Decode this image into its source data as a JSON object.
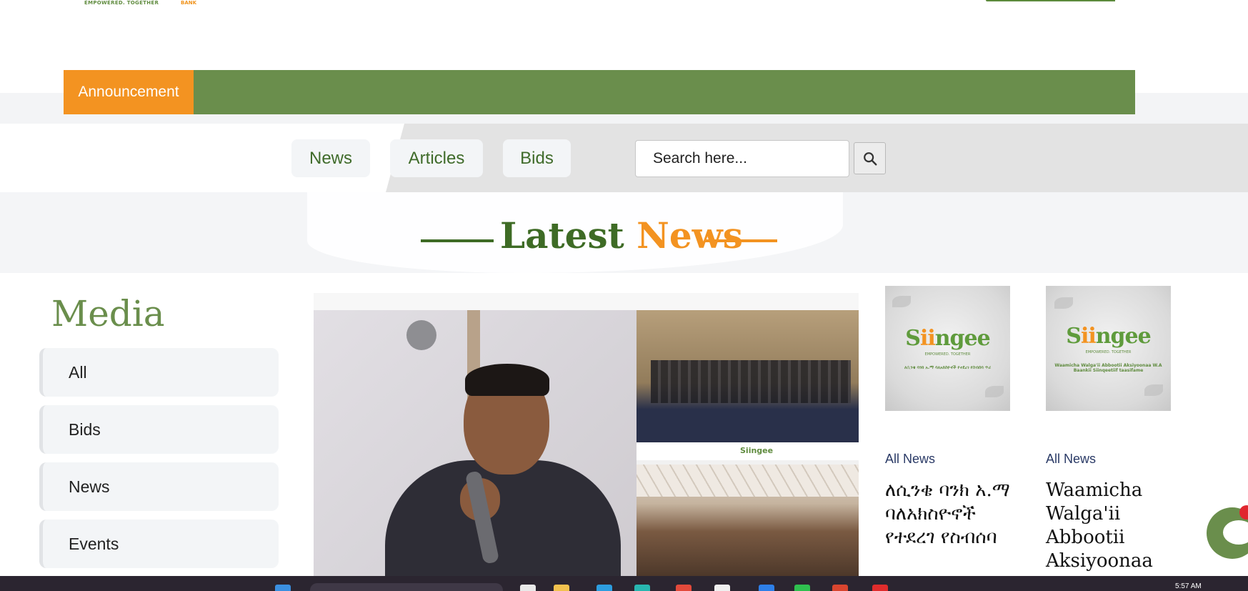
{
  "header": {
    "logo_tagline": "EMPOWERED. TOGETHER",
    "logo_bank": "BANK"
  },
  "announcement": {
    "label": "Announcement"
  },
  "tabs": [
    {
      "label": "News"
    },
    {
      "label": "Articles"
    },
    {
      "label": "Bids"
    }
  ],
  "search": {
    "placeholder": "Search here..."
  },
  "section": {
    "heading_part1": "Latest",
    "heading_part2": "News"
  },
  "sidebar": {
    "title": "Media",
    "items": [
      {
        "label": "All"
      },
      {
        "label": "Bids"
      },
      {
        "label": "News"
      },
      {
        "label": "Events"
      }
    ]
  },
  "feature": {
    "watermark": "Siingee"
  },
  "cards": [
    {
      "logo_a": "S",
      "logo_b": "ii",
      "logo_c": "ngee",
      "logo_sub": "EMPOWERED. TOGETHER",
      "logo_line": "ለሲንቄ ባንክ አ.ማ ባለአክስዮኖች የተደረገ የስብሰባ ጥሪ",
      "category": "All News",
      "title": "ለሲንቄ ባንክ አ.ማ ባለአክስዮኖች የተደረገ የስብሰባ"
    },
    {
      "logo_a": "S",
      "logo_b": "ii",
      "logo_c": "ngee",
      "logo_sub": "EMPOWERED. TOGETHER",
      "logo_line": "Waamicha Walga'ii Abbootii Aksiyoonaa W.A Baankii Siinqeetiif taasifame",
      "category": "All News",
      "title": "Waamicha Walga'ii Abbootii Aksiyoonaa"
    }
  ],
  "taskbar": {
    "time": "5:57 AM"
  },
  "colors": {
    "brand_green": "#6a8e4c",
    "dark_green": "#3e6b25",
    "brand_orange": "#f39321"
  }
}
